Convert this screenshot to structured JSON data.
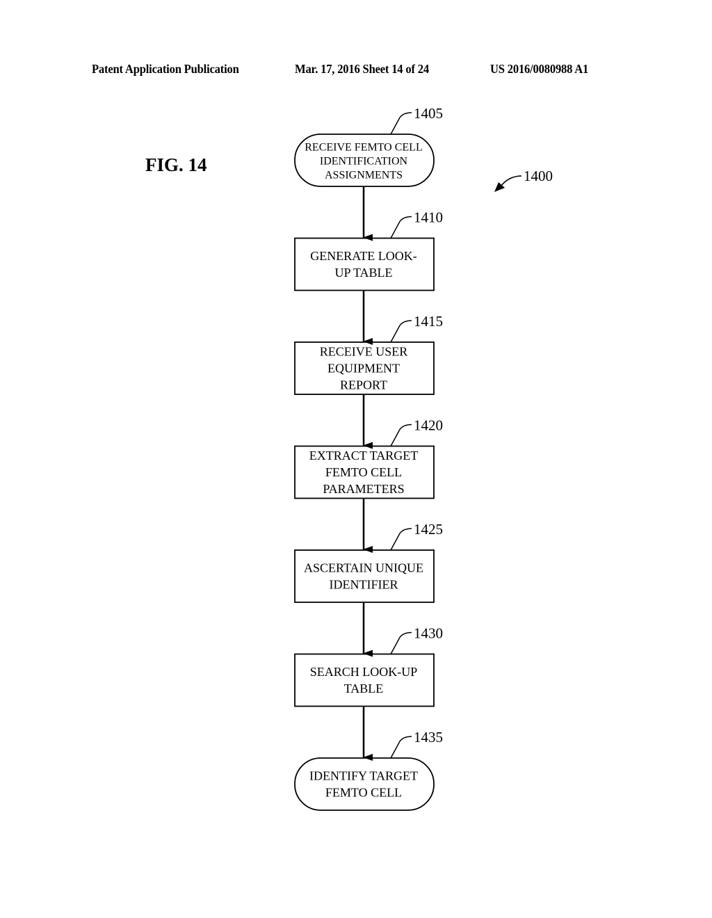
{
  "header": {
    "left": "Patent Application Publication",
    "middle": "Mar. 17, 2016  Sheet 14 of 24",
    "right": "US 2016/0080988 A1"
  },
  "figure": {
    "label": "FIG. 14",
    "ref": "1400"
  },
  "flowchart": {
    "nodes": [
      {
        "id": "1405",
        "shape": "terminal",
        "lines": [
          "RECEIVE FEMTO CELL",
          "IDENTIFICATION",
          "ASSIGNMENTS"
        ]
      },
      {
        "id": "1410",
        "shape": "process",
        "lines": [
          "GENERATE LOOK-",
          "UP TABLE"
        ]
      },
      {
        "id": "1415",
        "shape": "process",
        "lines": [
          "RECEIVE USER",
          "EQUIPMENT",
          "REPORT"
        ]
      },
      {
        "id": "1420",
        "shape": "process",
        "lines": [
          "EXTRACT TARGET",
          "FEMTO CELL",
          "PARAMETERS"
        ]
      },
      {
        "id": "1425",
        "shape": "process",
        "lines": [
          "ASCERTAIN UNIQUE",
          "IDENTIFIER"
        ]
      },
      {
        "id": "1430",
        "shape": "process",
        "lines": [
          "SEARCH LOOK-UP",
          "TABLE"
        ]
      },
      {
        "id": "1435",
        "shape": "terminal",
        "lines": [
          "IDENTIFY TARGET",
          "FEMTO CELL"
        ]
      }
    ],
    "edges": [
      [
        "1405",
        "1410"
      ],
      [
        "1410",
        "1415"
      ],
      [
        "1415",
        "1420"
      ],
      [
        "1420",
        "1425"
      ],
      [
        "1425",
        "1430"
      ],
      [
        "1430",
        "1435"
      ]
    ]
  }
}
